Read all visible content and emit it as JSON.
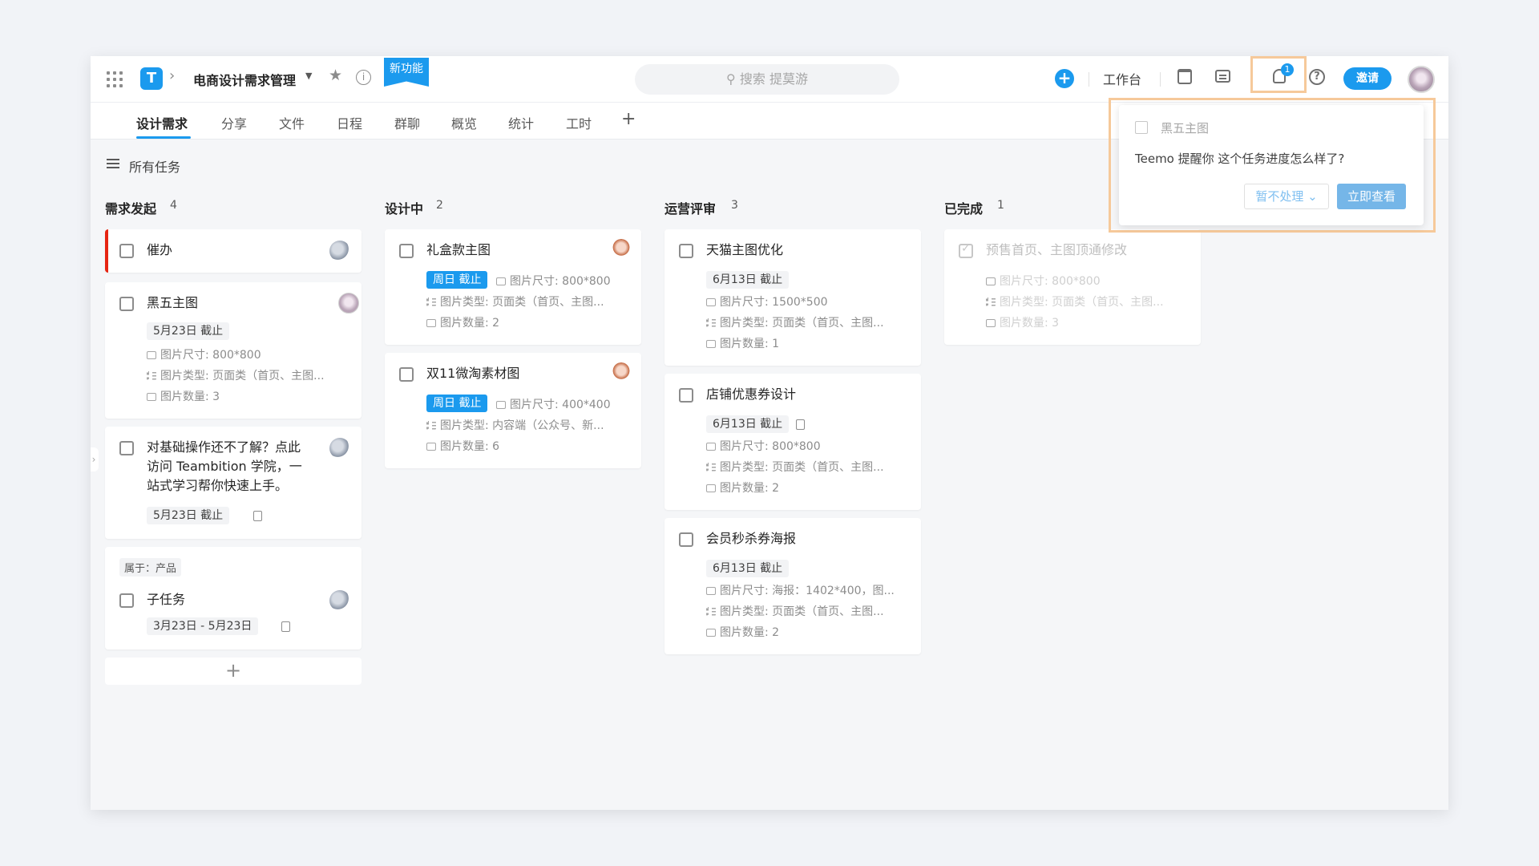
{
  "header": {
    "project_title": "电商设计需求管理",
    "new_badge": "新功能",
    "search_placeholder": "搜索 提莫游",
    "workbench": "工作台",
    "notification_count": "1",
    "invite": "邀请"
  },
  "tabs": [
    "设计需求",
    "分享",
    "文件",
    "日程",
    "群聊",
    "概览",
    "统计",
    "工时"
  ],
  "filter_label": "所有任务",
  "columns": [
    {
      "title": "需求发起",
      "count": "4",
      "cards": [
        {
          "title": "催办"
        },
        {
          "title": "黑五主图",
          "due": "5月23日 截止",
          "size": "图片尺寸: 800*800",
          "type": "图片类型: 页面类（首页、主图...",
          "qty": "图片数量: 3"
        },
        {
          "title_lines": [
            "对基础操作还不了解？点此",
            "访问 Teambition 学院，一",
            "站式学习帮你快速上手。"
          ],
          "due": "5月23日 截止"
        },
        {
          "belongs": "属于：产品",
          "title": "子任务",
          "due": "3月23日 - 5月23日"
        }
      ]
    },
    {
      "title": "设计中",
      "count": "2",
      "cards": [
        {
          "title": "礼盒款主图",
          "due": "周日 截止",
          "size": "图片尺寸: 800*800",
          "type": "图片类型: 页面类（首页、主图...",
          "qty": "图片数量: 2"
        },
        {
          "title": "双11微淘素材图",
          "due": "周日 截止",
          "size": "图片尺寸: 400*400",
          "type": "图片类型: 内容端（公众号、新...",
          "qty": "图片数量: 6"
        }
      ]
    },
    {
      "title": "运营评审",
      "count": "3",
      "cards": [
        {
          "title": "天猫主图优化",
          "due": "6月13日 截止",
          "size": "图片尺寸: 1500*500",
          "type": "图片类型: 页面类（首页、主图...",
          "qty": "图片数量: 1"
        },
        {
          "title": "店铺优惠券设计",
          "due": "6月13日 截止",
          "size": "图片尺寸: 800*800",
          "type": "图片类型: 页面类（首页、主图...",
          "qty": "图片数量: 2"
        },
        {
          "title": "会员秒杀券海报",
          "due": "6月13日 截止",
          "size": "图片尺寸: 海报：1402*400，图...",
          "type": "图片类型: 页面类（首页、主图...",
          "qty": "图片数量: 2"
        }
      ]
    },
    {
      "title": "已完成",
      "count": "1",
      "cards": [
        {
          "title": "预售首页、主图顶通修改",
          "size": "图片尺寸: 800*800",
          "type": "图片类型: 页面类（首页、主图...",
          "qty": "图片数量: 3"
        }
      ]
    }
  ],
  "popup": {
    "task": "黑五主图",
    "message": "Teemo 提醒你 这个任务进度怎么样了?",
    "ignore": "暂不处理",
    "view": "立即查看"
  },
  "colors": {
    "accent": "#1b9aee",
    "urgent": "#e62412",
    "highlight": "#f6c99a"
  }
}
